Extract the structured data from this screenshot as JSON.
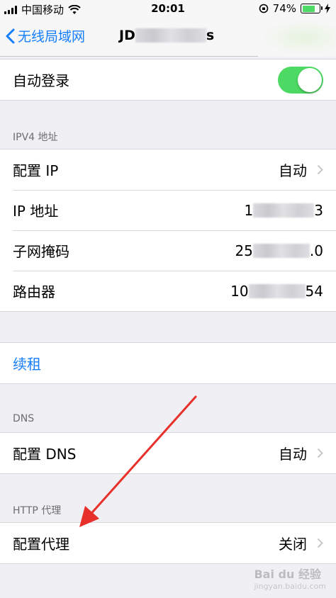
{
  "status_bar": {
    "carrier": "中国移动",
    "time": "20:01",
    "battery": "74%",
    "battery_level": 0.74
  },
  "nav": {
    "back_label": "无线局域网",
    "title_prefix": "JD",
    "title_suffix": "s"
  },
  "auto_login": {
    "label": "自动登录",
    "enabled": true
  },
  "ipv4": {
    "header": "IPV4 地址",
    "rows": [
      {
        "label": "配置 IP",
        "value": "自动"
      },
      {
        "label": "IP 地址",
        "value_start": "1",
        "value_end": "3"
      },
      {
        "label": "子网掩码",
        "value_start": "25",
        "value_end": ".0"
      },
      {
        "label": "路由器",
        "value_start": "10",
        "value_end": "54"
      }
    ]
  },
  "renew": {
    "label": "续租"
  },
  "dns": {
    "header": "DNS",
    "row": {
      "label": "配置 DNS",
      "value": "自动"
    }
  },
  "proxy": {
    "header": "HTTP 代理",
    "row": {
      "label": "配置代理",
      "value": "关闭"
    }
  },
  "watermark": {
    "text": "Bai du 经验",
    "sub": "jingyan.baidu.com"
  },
  "colors": {
    "accent": "#157efb",
    "toggle_on": "#4cd964",
    "arrow": "#e8302a",
    "background": "#efeff4"
  }
}
